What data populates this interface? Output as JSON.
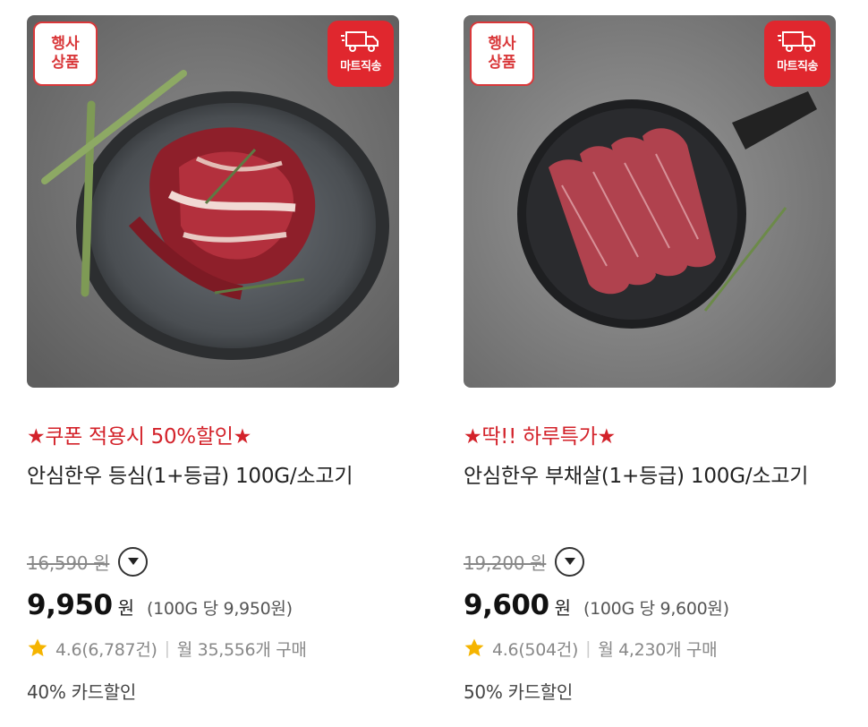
{
  "products": [
    {
      "event_badge": [
        "행사",
        "상품"
      ],
      "delivery_badge": "마트직송",
      "promo": "★쿠폰 적용시 50%할인★",
      "name": "안심한우 등심(1+등급) 100G/소고기",
      "original_price": "16,590 원",
      "price": "9,950",
      "currency": "원",
      "unit_price": "(100G 당 9,950원)",
      "rating": "4.6(6,787건)",
      "monthly_sales": "월 35,556개 구매",
      "card_discount": "40% 카드할인",
      "icons": [
        "star-icon",
        "chevron-down-icon",
        "truck-icon"
      ]
    },
    {
      "event_badge": [
        "행사",
        "상품"
      ],
      "delivery_badge": "마트직송",
      "promo": "★딱!! 하루특가★",
      "name": "안심한우 부채살(1+등급) 100G/소고기",
      "original_price": "19,200 원",
      "price": "9,600",
      "currency": "원",
      "unit_price": "(100G 당 9,600원)",
      "rating": "4.6(504건)",
      "monthly_sales": "월 4,230개 구매",
      "card_discount": "50% 카드할인",
      "icons": [
        "star-icon",
        "chevron-down-icon",
        "truck-icon"
      ]
    }
  ],
  "colors": {
    "promo": "#d3222a",
    "badge_red": "#e0272e",
    "star": "#f5b400"
  }
}
